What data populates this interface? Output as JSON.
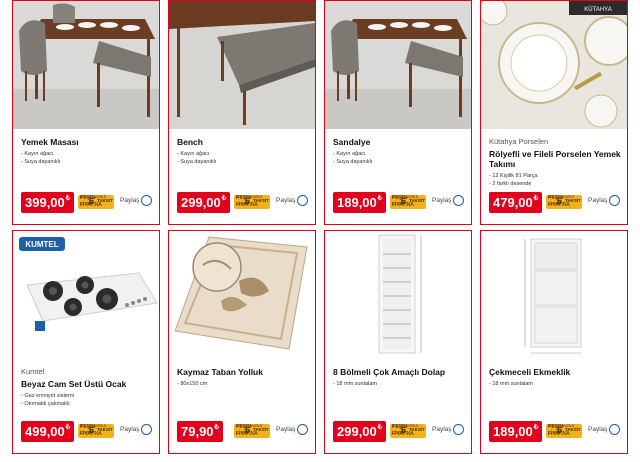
{
  "products": [
    {
      "brand": "",
      "title": "Yemek Masası",
      "features": [
        "- Kayın ağacı",
        "- Suya dayanıklı"
      ],
      "price": "399,00",
      "currency": "₺"
    },
    {
      "brand": "",
      "title": "Bench",
      "features": [
        "- Kayın ağacı",
        "- Suya dayanıklı"
      ],
      "price": "299,00",
      "currency": "₺"
    },
    {
      "brand": "",
      "title": "Sandalye",
      "features": [
        "- Kayın ağacı",
        "- Suya dayanıklı"
      ],
      "price": "189,00",
      "currency": "₺"
    },
    {
      "brand": "Kütahya Porselen",
      "title": "Rölyefli ve Fileli Porselen Yemek Takımı",
      "features": [
        "- 12 Kişilik 81 Parça",
        "- 2 farklı desende"
      ],
      "price": "479,00",
      "currency": "₺"
    },
    {
      "brand": "Kumtel",
      "title": "Beyaz Cam Set Üstü Ocak",
      "features": [
        "- Gaz emniyet sistemi",
        "- Otomatik çakmaklı"
      ],
      "price": "499,00",
      "currency": "₺"
    },
    {
      "brand": "",
      "title": "Kaymaz Taban Yolluk",
      "features": [
        "- 80x150 cm"
      ],
      "price": "79,90",
      "currency": "₺"
    },
    {
      "brand": "",
      "title": "8 Bölmeli Çok Amaçlı Dolap",
      "features": [
        "- 18 mm suntalam"
      ],
      "price": "299,00",
      "currency": "₺"
    },
    {
      "brand": "",
      "title": "Çekmeceli Ekmeklik",
      "features": [
        "- 18 mm suntalam"
      ],
      "price": "189,00",
      "currency": "₺"
    }
  ],
  "installment": {
    "top": "PEŞİN FİYATINA",
    "count": "6",
    "label": "TAKSİT",
    "sub": "BONUS  WORLD  AXESS"
  },
  "share_label": "Paylaş",
  "image_labels": {
    "kutahya_logo": "KÜTAHYA",
    "kumtel_logo": "KUMTEL"
  },
  "colors": {
    "accent": "#e3001b",
    "installment_badge": "#f2b21c",
    "radio": "#1a5fb4"
  }
}
